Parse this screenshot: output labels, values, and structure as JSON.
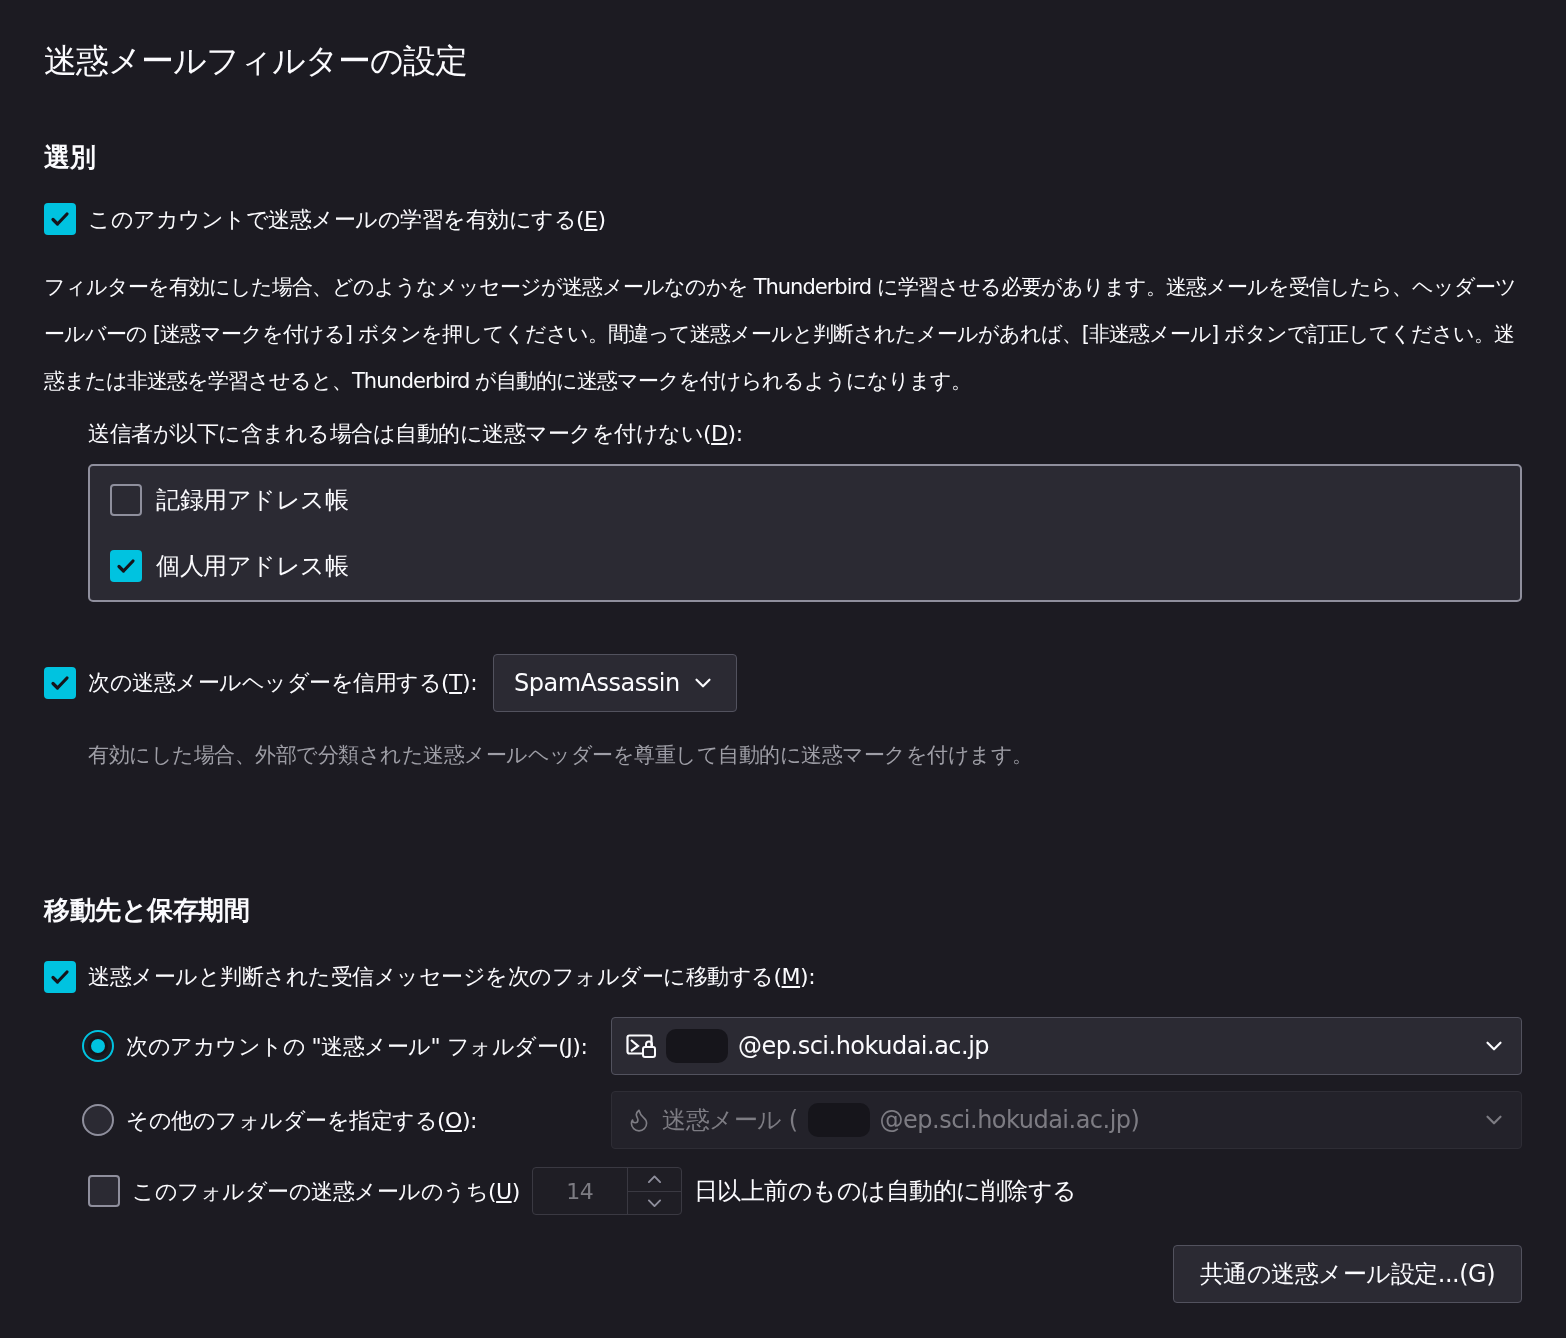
{
  "title": "迷惑メールフィルターの設定",
  "selection": {
    "heading": "選別",
    "learn": {
      "checked": true,
      "label": {
        "before": "このアカウントで迷惑メールの学習を有効にする(",
        "key": "E",
        "after": ")"
      }
    },
    "description": "フィルターを有効にした場合、どのようなメッセージが迷惑メールなのかを Thunderbird に学習させる必要があります。迷惑メールを受信したら、ヘッダーツールバーの [迷惑マークを付ける] ボタンを押してください。間違って迷惑メールと判断されたメールがあれば、[非迷惑メール] ボタンで訂正してください。迷惑または非迷惑を学習させると、Thunderbird が自動的に迷惑マークを付けられるようになります。",
    "whitelist_label": {
      "before": "送信者が以下に含まれる場合は自動的に迷惑マークを付けない(",
      "key": "D",
      "after": "):"
    },
    "address_books": [
      {
        "label": "記録用アドレス帳",
        "checked": false
      },
      {
        "label": "個人用アドレス帳",
        "checked": true
      }
    ],
    "trust_header": {
      "checked": true,
      "label": {
        "before": "次の迷惑メールヘッダーを信用する(",
        "key": "T",
        "after": "):"
      },
      "value": "SpamAssassin"
    },
    "trust_hint": "有効にした場合、外部で分類された迷惑メールヘッダーを尊重して自動的に迷惑マークを付けます。"
  },
  "destination": {
    "heading": "移動先と保存期間",
    "move": {
      "checked": true,
      "label": {
        "before": "迷惑メールと判断された受信メッセージを次のフォルダーに移動する(",
        "key": "M",
        "after": "):"
      }
    },
    "options": [
      {
        "selected": true,
        "label": {
          "before": "次のアカウントの \"迷惑メール\" フォルダー(",
          "key": "J",
          "after": "):"
        },
        "disabled": false,
        "value": "@ep.sci.hokudai.ac.jp"
      },
      {
        "selected": false,
        "label": {
          "before": "その他のフォルダーを指定する(",
          "key": "O",
          "after": "):"
        },
        "disabled": true,
        "prefix": "迷惑メール (",
        "value": "@ep.sci.hokudai.ac.jp)"
      }
    ],
    "purge": {
      "checked": false,
      "label": {
        "before": "このフォルダーの迷惑メールのうち(",
        "key": "U",
        "after": ")"
      },
      "days": "14",
      "after": "日以上前のものは自動的に削除する"
    },
    "button": "共通の迷惑メール設定...(G)"
  }
}
